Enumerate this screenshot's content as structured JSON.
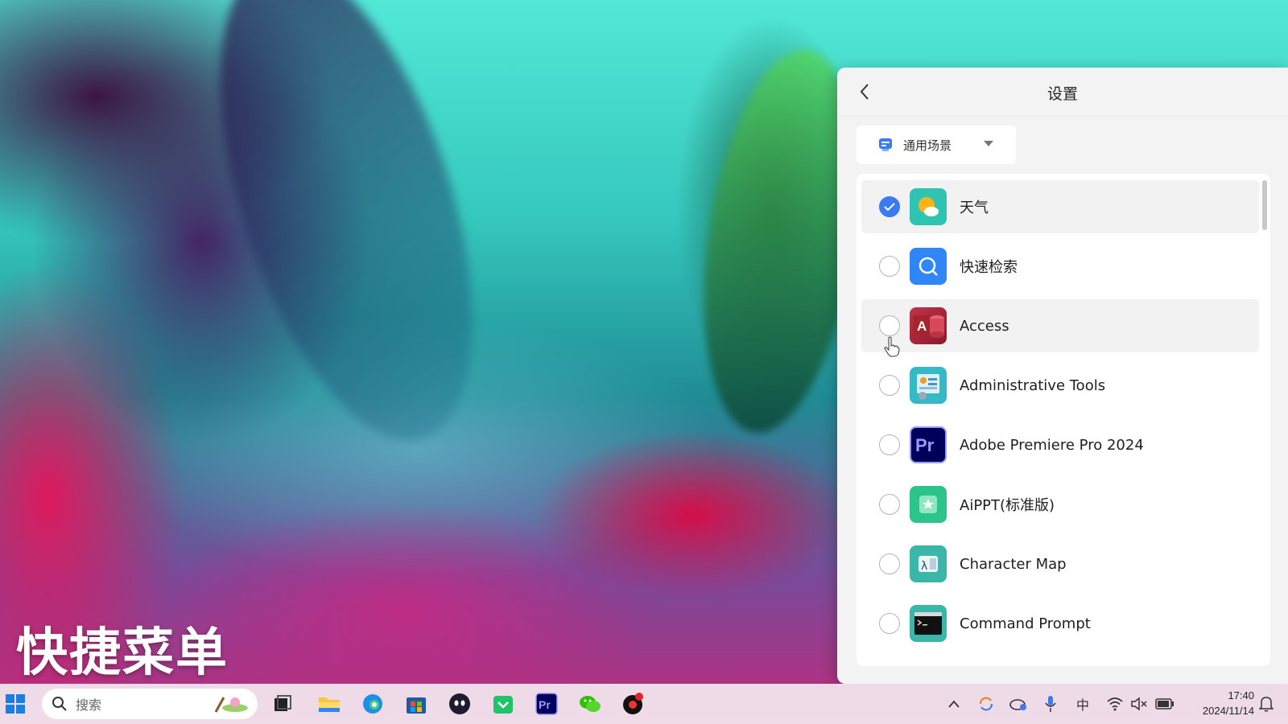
{
  "overlay": {
    "title": "快捷菜单"
  },
  "settings_panel": {
    "title": "设置",
    "scene_dropdown": {
      "selected": "通用场景"
    },
    "items": [
      {
        "label": "天气",
        "checked": true,
        "icon": "weather-icon"
      },
      {
        "label": "快速检索",
        "checked": false,
        "icon": "quick-search-icon"
      },
      {
        "label": "Access",
        "checked": false,
        "icon": "access-app-icon",
        "hovered": true
      },
      {
        "label": "Administrative Tools",
        "checked": false,
        "icon": "admin-tools-icon"
      },
      {
        "label": "Adobe Premiere Pro 2024",
        "checked": false,
        "icon": "premiere-pro-icon"
      },
      {
        "label": "AiPPT(标准版)",
        "checked": false,
        "icon": "aippt-icon"
      },
      {
        "label": "Character Map",
        "checked": false,
        "icon": "character-map-icon"
      },
      {
        "label": "Command Prompt",
        "checked": false,
        "icon": "command-prompt-icon"
      }
    ]
  },
  "taskbar": {
    "search": {
      "placeholder": "搜索"
    },
    "pinned": [
      "start-icon",
      "task-view-icon",
      "file-explorer-icon",
      "edge-icon",
      "store-icon",
      "chat-app-icon",
      "shopping-app-icon",
      "premiere-pro-icon",
      "wechat-icon",
      "media-app-icon"
    ],
    "tray": {
      "ime": "中"
    },
    "clock": {
      "time": "17:40",
      "date": "2024/11/14"
    }
  },
  "colors": {
    "accent": "#3a7bf0",
    "panel_bg": "#f3f3f3",
    "taskbar_bg": "#f3e8f0"
  }
}
